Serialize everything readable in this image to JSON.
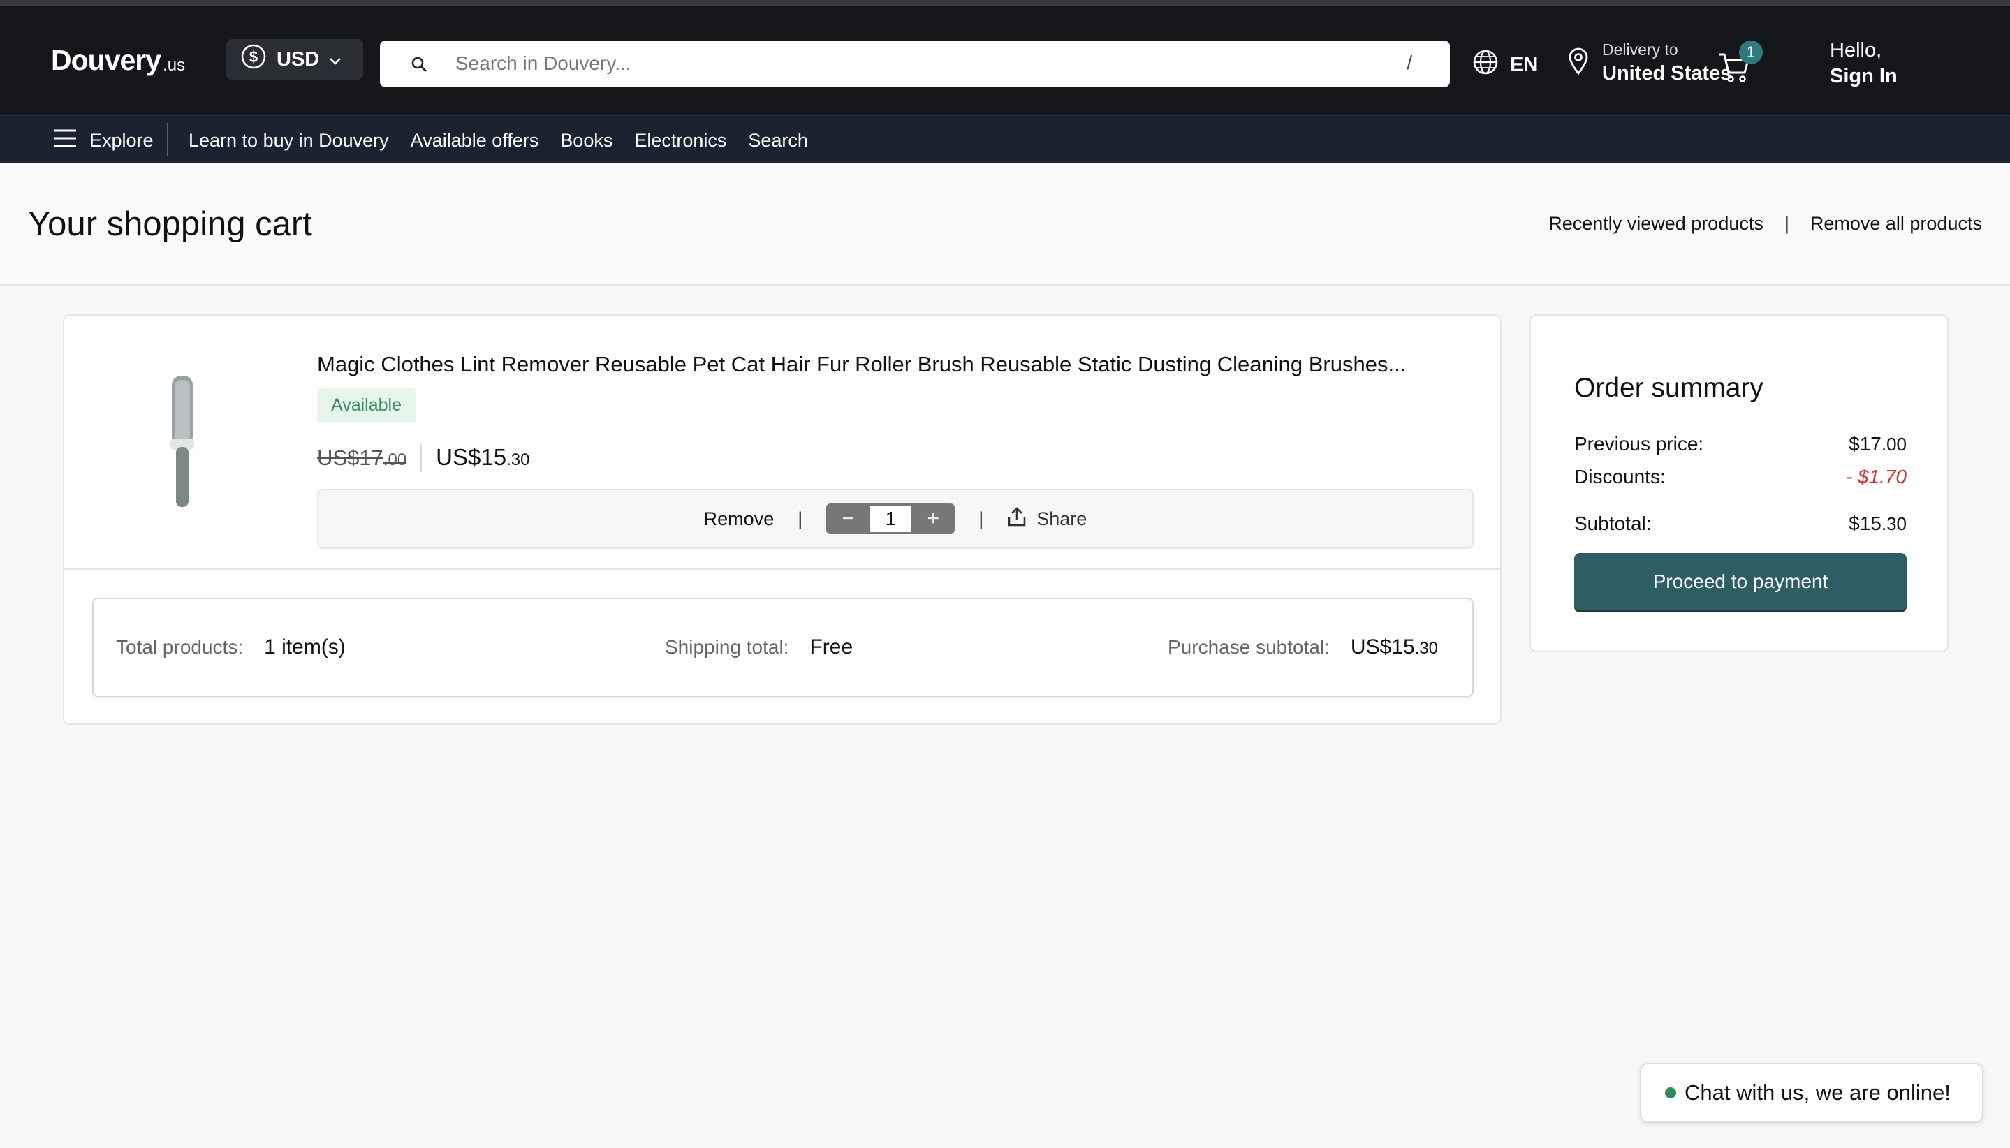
{
  "header": {
    "logo_main": "Douvery",
    "logo_tld": ".us",
    "currency": "USD",
    "search_placeholder": "Search in Douvery...",
    "search_shortcut": "/",
    "language": "EN",
    "delivery_label": "Delivery to",
    "delivery_country": "United States",
    "cart_count": "1",
    "greeting": "Hello,",
    "signin": "Sign In"
  },
  "nav": {
    "explore": "Explore",
    "links": [
      "Learn to buy in Douvery",
      "Available offers",
      "Books",
      "Electronics",
      "Search"
    ]
  },
  "page": {
    "title": "Your shopping cart",
    "recently_viewed": "Recently viewed products",
    "separator": "|",
    "remove_all": "Remove all products"
  },
  "cart_item": {
    "name": "Magic Clothes Lint Remover Reusable Pet Cat Hair Fur Roller Brush Reusable Static Dusting Cleaning Brushes...",
    "availability": "Available",
    "old_price_main": "US$17",
    "old_price_cents": ".00",
    "new_price_main": "US$15",
    "new_price_cents": ".30",
    "remove_label": "Remove",
    "quantity": "1",
    "minus": "−",
    "plus": "+",
    "share_label": "Share"
  },
  "totals": {
    "products_label": "Total products:",
    "products_value": "1 item(s)",
    "shipping_label": "Shipping total:",
    "shipping_value": "Free",
    "subtotal_label": "Purchase subtotal:",
    "subtotal_main": "US$15",
    "subtotal_cents": ".30"
  },
  "summary": {
    "title": "Order summary",
    "previous_label": "Previous price:",
    "previous_main": "$17",
    "previous_cents": ".00",
    "discount_label": "Discounts:",
    "discount_value": "- $1.70",
    "subtotal_label": "Subtotal:",
    "subtotal_main": "$15",
    "subtotal_cents": ".30",
    "pay_button": "Proceed to payment"
  },
  "chat": {
    "label": "Chat with us, we are online!"
  },
  "colors": {
    "header_bg": "#14161a",
    "nav_bg": "#1c2330",
    "accent": "#2f5d64",
    "badge": "#2f7a80",
    "available_text": "#3a8a5c",
    "discount": "#d03030",
    "online_dot": "#2f8a5c"
  },
  "icons": [
    "dollar-circle-icon",
    "chevron-down-icon",
    "search-icon",
    "globe-icon",
    "location-pin-icon",
    "cart-icon",
    "hamburger-menu-icon",
    "share-icon"
  ]
}
